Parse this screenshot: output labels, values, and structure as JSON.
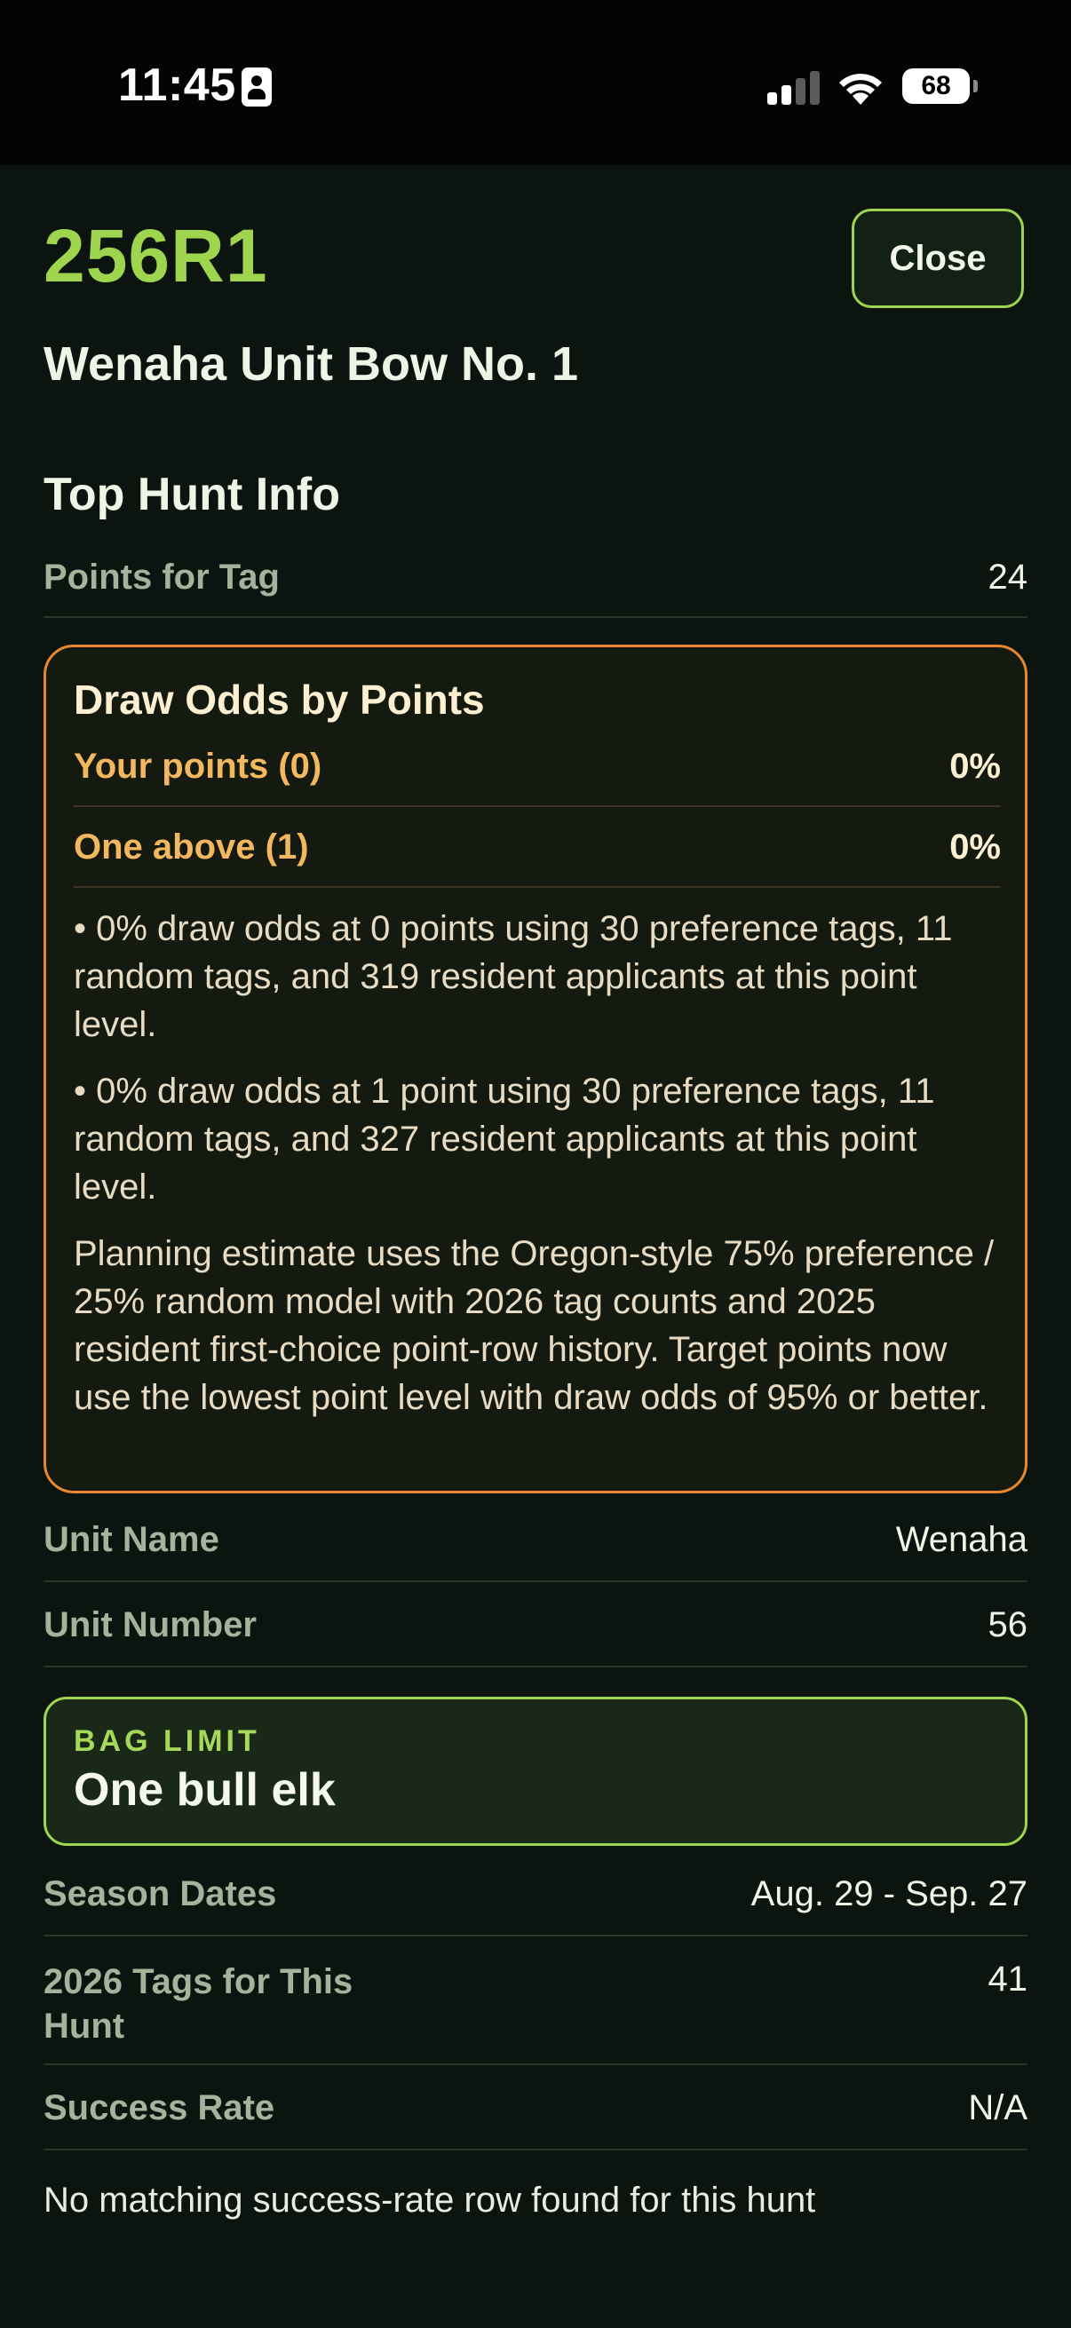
{
  "status": {
    "time": "11:45",
    "battery": "68"
  },
  "header": {
    "hunt_code": "256R1",
    "close_label": "Close",
    "hunt_name": "Wenaha Unit Bow No. 1"
  },
  "top_info": {
    "title": "Top Hunt Info",
    "points_for_tag": {
      "label": "Points for Tag",
      "value": "24"
    }
  },
  "draw_odds": {
    "title": "Draw Odds by Points",
    "rows": [
      {
        "label": "Your points (0)",
        "value": "0%"
      },
      {
        "label": "One above (1)",
        "value": "0%"
      }
    ],
    "notes": [
      "• 0% draw odds at 0 points using 30 preference tags, 11 random tags, and 319 resident applicants at this point level.",
      "• 0% draw odds at 1 point using 30 preference tags, 11 random tags, and 327 resident applicants at this point level."
    ],
    "explanation": "Planning estimate uses the Oregon-style 75% preference / 25% random model with 2026 tag counts and 2025 resident first-choice point-row history. Target points now use the lowest point level with draw odds of 95% or better."
  },
  "details": {
    "unit_name": {
      "label": "Unit Name",
      "value": "Wenaha"
    },
    "unit_number": {
      "label": "Unit Number",
      "value": "56"
    },
    "bag_limit": {
      "label": "BAG LIMIT",
      "value": "One bull elk"
    },
    "season_dates": {
      "label": "Season Dates",
      "value": "Aug. 29 - Sep. 27"
    },
    "tags": {
      "label": "2026 Tags for This Hunt",
      "value": "41"
    },
    "success_rate": {
      "label": "Success Rate",
      "value": "N/A"
    }
  },
  "footnote": "No matching success-rate row found for this hunt",
  "colors": {
    "accent_green": "#9fd44f",
    "accent_orange": "#e8872e",
    "background": "#0b140e"
  }
}
